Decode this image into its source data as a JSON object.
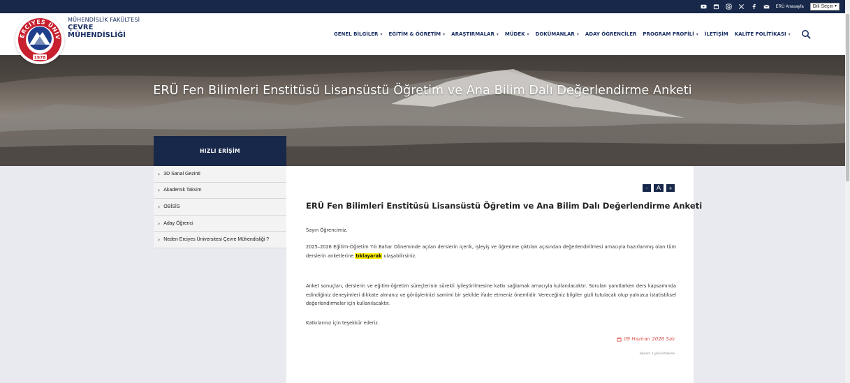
{
  "topbar": {
    "icons": [
      "youtube-icon",
      "calendar-icon",
      "instagram-icon",
      "x-icon",
      "facebook-icon",
      "mail-icon"
    ],
    "home_link": "ERÜ Anasayfa",
    "language_select": "Dili Seçin"
  },
  "logo": {
    "ring_text": "ERCİYES ÜNİVERSİTESİ",
    "year": "1978"
  },
  "brand": {
    "faculty": "MÜHENDİSLİK FAKÜLTESİ",
    "department_line1": "ÇEVRE",
    "department_line2": "MÜHENDİSLİĞİ"
  },
  "nav": {
    "items": [
      {
        "label": "GENEL BİLGİLER",
        "dropdown": true
      },
      {
        "label": "EĞİTİM & ÖĞRETİM",
        "dropdown": true
      },
      {
        "label": "ARAŞTIRMALAR",
        "dropdown": true
      },
      {
        "label": "MÜDEK",
        "dropdown": true
      },
      {
        "label": "DOKÜMANLAR",
        "dropdown": true
      },
      {
        "label": "ADAY ÖĞRENCİLER",
        "dropdown": false
      },
      {
        "label": "PROGRAM PROFİLİ",
        "dropdown": true
      },
      {
        "label": "İLETİŞİM",
        "dropdown": false
      },
      {
        "label": "KALİTE POLİTİKASI",
        "dropdown": true
      }
    ]
  },
  "hero": {
    "title": "ERÜ Fen Bilimleri Enstitüsü Lisansüstü Öğretim ve Ana Bilim Dalı Değerlendirme Anketi"
  },
  "quick_access": {
    "heading": "HIZLI ERİŞİM",
    "items": [
      "3D Sanal Gezinti",
      "Akademik Takvim",
      "OBİSİS",
      "Aday Öğrenci",
      "Neden Erciyes Üniversitesi Çevre Mühendisliği ?"
    ]
  },
  "content": {
    "font_controls": [
      "-",
      "A",
      "+"
    ],
    "title": "ERÜ Fen Bilimleri Enstitüsü Lisansüstü Öğretim ve Ana Bilim Dalı Değerlendirme Anketi",
    "greeting": "Sayın Öğrencimiz,",
    "para1_before": " 2025–2026 Eğitim-Öğretim Yılı Bahar Döneminde açılan derslerin içerik, işleyiş ve öğrenme çıktıları açısından değerlendirilmesi amacıyla hazırlanmış olan tüm derslerin anketlerine ",
    "para1_link": "tıklayarak",
    "para1_after": " ulaşabilirsiniz.",
    "para2": "Anket sonuçları, derslerin ve eğitim-öğretim süreçlerinin sürekli iyileştirilmesine katkı sağlamak amacıyla kullanılacaktır. Soruları yanıtlarken ders kapsamında edindiğiniz deneyimleri dikkate almanız ve görüşlerinizi samimi bir şekilde ifade etmeniz önemlidir. Vereceğiniz bilgiler gizli tutulacak olup yalnızca istatistiksel değerlendirmeler için kullanılacaktır.",
    "thanks": "Katkılarınız için teşekkür ederiz.",
    "date": "09 Haziran 2026 Salı",
    "views": "Toplam 1 görüntüleme"
  },
  "colors": {
    "navy": "#17284a",
    "brand_text": "#1a2f63",
    "highlight": "#fff200",
    "date_red": "#d9534f"
  }
}
